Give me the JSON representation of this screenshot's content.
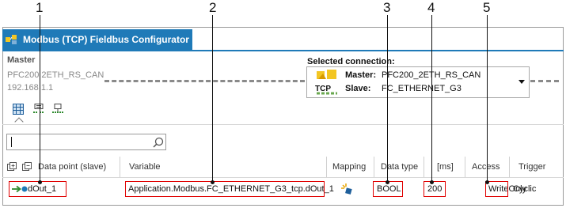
{
  "callouts": [
    "1",
    "2",
    "3",
    "4",
    "5"
  ],
  "window": {
    "title": "Modbus (TCP) Fieldbus Configurator"
  },
  "master": {
    "label": "Master",
    "device": "PFC200 2ETH_RS_CAN",
    "ip": "192.168 1.1"
  },
  "connection": {
    "label": "Selected connection:",
    "master_label": "Master:",
    "master_value": "PFC200_2ETH_RS_CAN",
    "slave_label": "Slave:",
    "slave_value": "FC_ETHERNET_G3",
    "icon_caption": "TCP"
  },
  "view_icons": [
    "table-view-icon",
    "tree-view-icon",
    "network-view-icon"
  ],
  "search": {
    "value": "",
    "placeholder": ""
  },
  "table": {
    "columns": [
      "Data point (slave)",
      "Variable",
      "Mapping",
      "Data type",
      "[ms]",
      "Access",
      "Trigger"
    ],
    "rows": [
      {
        "data_point": "dOut_1",
        "variable": "Application.Modbus.FC_ETHERNET_G3_tcp.dOut_1",
        "mapping_icon": "mapping-icon",
        "data_type": "BOOL",
        "interval": "200",
        "access": "WriteOnly",
        "trigger": "Cyclic"
      }
    ]
  },
  "colors": {
    "accent": "#1f7ab8",
    "highlight": "#e00000"
  }
}
